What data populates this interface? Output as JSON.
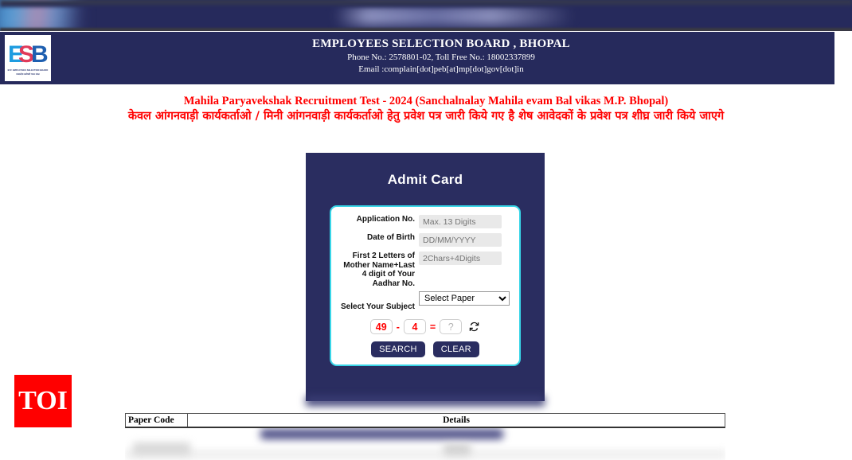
{
  "top_banner": {
    "note": "blurred site banner"
  },
  "header": {
    "logo": {
      "text": "ESB",
      "caption_line1": "M.P. EMPLOYEES SELECTION BOARD",
      "caption_line2": "मध्यप्रदेश कर्मचारी चयन मंडल"
    },
    "title": "EMPLOYEES SELECTION BOARD , BHOPAL",
    "phone": "Phone No.: 2578801-02, Toll Free No.: 18002337899",
    "email": "Email :complain[dot]peb[at]mp[dot]gov[dot]in",
    "bg_color": "#262a5c"
  },
  "notice": {
    "line_en": "Mahila Paryavekshak Recruitment Test - 2024 (Sanchalnalay Mahila evam Bal vikas M.P. Bhopal)",
    "line_hi": "केवल आंगनवाड़ी कार्यकर्ताओ / मिनी आंगनवाड़ी कार्यकर्ताओ हेतु प्रवेश पत्र जारी किये गए है शेष आवेदकों के प्रवेश पत्र शीघ्र जारी किये जाएगे",
    "color": "#ff0000"
  },
  "panel": {
    "title": "Admit Card",
    "bg_color": "#2a2d60",
    "card_border_color": "#39d6e8"
  },
  "form": {
    "application_no": {
      "label": "Application No.",
      "placeholder": "Max. 13 Digits",
      "value": ""
    },
    "date_of_birth": {
      "label": "Date of Birth",
      "placeholder": "DD/MM/YYYY",
      "value": ""
    },
    "aadhar": {
      "label": "First 2 Letters of Mother Name+Last 4 digit of Your Aadhar No.",
      "placeholder": "2Chars+4Digits",
      "value": ""
    },
    "subject": {
      "label": "Select Your Subject",
      "selected": "Select Paper",
      "options": [
        "Select Paper"
      ]
    },
    "captcha": {
      "operand1": "49",
      "operator": "-",
      "operand2": "4",
      "equals": "=",
      "answer_placeholder": "?",
      "answer_value": "",
      "refresh_icon": "refresh-icon"
    },
    "buttons": {
      "search": "SEARCH",
      "clear": "CLEAR"
    }
  },
  "watermark": {
    "text": "TOI",
    "bg_color": "#ff0000"
  },
  "results_table": {
    "columns": [
      "Paper Code",
      "Details"
    ],
    "rows": []
  }
}
